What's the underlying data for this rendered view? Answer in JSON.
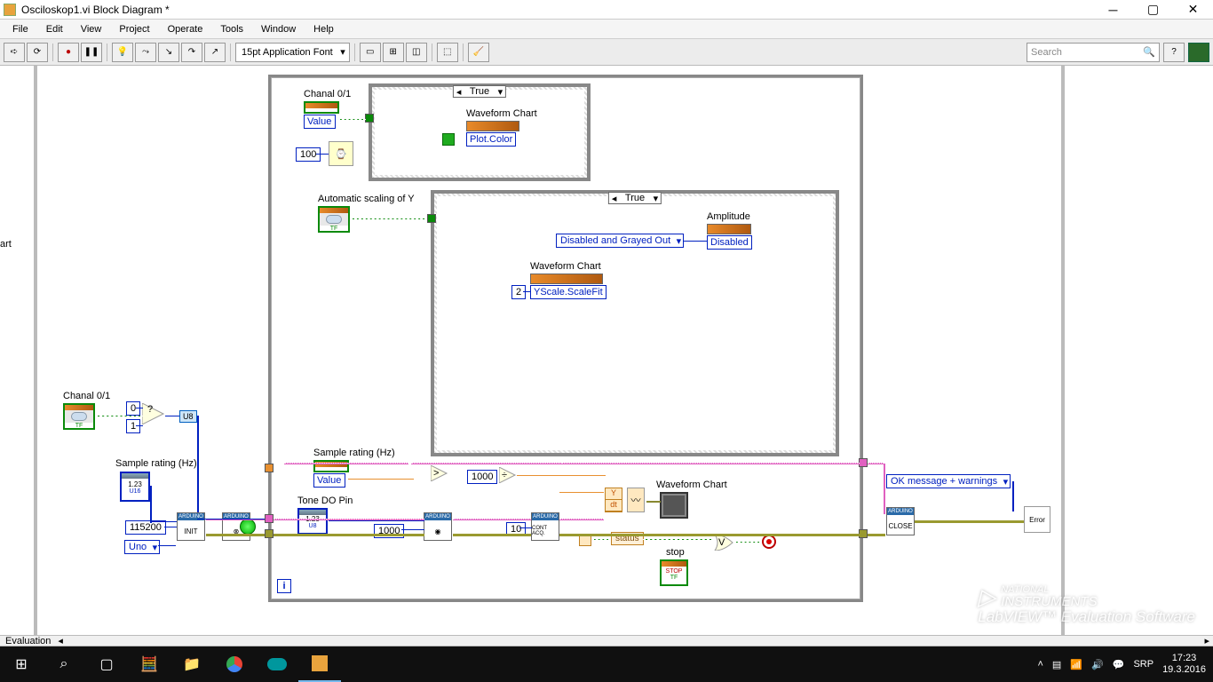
{
  "window": {
    "title": "Osciloskop1.vi Block Diagram *"
  },
  "menu": {
    "file": "File",
    "edit": "Edit",
    "view": "View",
    "project": "Project",
    "operate": "Operate",
    "tools": "Tools",
    "window": "Window",
    "help": "Help"
  },
  "toolbar": {
    "font": "15pt Application Font",
    "search_placeholder": "Search"
  },
  "diagram": {
    "chanal_top": "Chanal 0/1",
    "value": "Value",
    "c100": "100",
    "true": "True",
    "wfchart": "Waveform Chart",
    "plotcolor": "Plot.Color",
    "autoy": "Automatic scaling of Y",
    "disabled_gray": "Disabled and Grayed Out",
    "amplitude": "Amplitude",
    "disabled": "Disabled",
    "c2": "2",
    "yscale": "YScale.ScaleFit",
    "chanal_left": "Chanal 0/1",
    "c0": "0",
    "c1": "1",
    "u8": "U8",
    "sample_left": "Sample rating (Hz)",
    "sample_mid": "Sample rating (Hz)",
    "tone": "Tone DO Pin",
    "c115200": "115200",
    "uno": "Uno",
    "c1000a": "1000",
    "c1000b": "1000",
    "c10": "10",
    "status": "status",
    "stop": "stop",
    "okmsg": "OK message + warnings",
    "error": "Error",
    "initlbl": "INIT",
    "closelbl": "CLOSE",
    "acqlbl": "CONT ACQ.",
    "stp": "STOP",
    "y": "Y",
    "dt": "dt"
  },
  "eval": "Evaluation",
  "taskbar": {
    "lang": "SRP",
    "time": "17:23",
    "date": "19.3.2016"
  },
  "watermark": {
    "l1": "NATIONAL",
    "l2": "INSTRUMENTS",
    "l3": "LabVIEW™ Evaluation Software"
  }
}
